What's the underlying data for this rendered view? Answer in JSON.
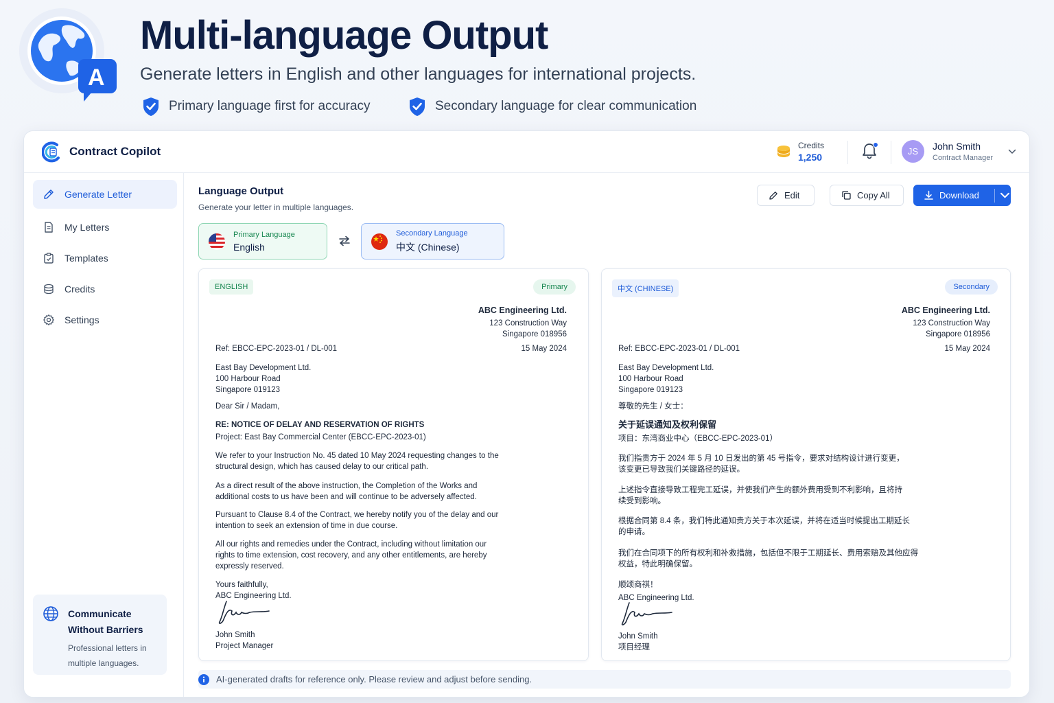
{
  "hero": {
    "title": "Multi-language Output",
    "subtitle": "Generate letters in English and other languages for international projects.",
    "badge_letter": "A",
    "features": [
      "Primary language first for accuracy",
      "Secondary language for clear communication"
    ]
  },
  "app": {
    "brand_name": "Contract Copilot",
    "credits_label": "Credits",
    "credits_value": "1,250",
    "user": {
      "initials": "JS",
      "name": "John Smith",
      "role": "Contract Manager"
    }
  },
  "sidebar": {
    "items": [
      {
        "label": "Generate Letter",
        "icon": "pencil-icon"
      },
      {
        "label": "My Letters",
        "icon": "document-icon"
      },
      {
        "label": "Templates",
        "icon": "clipboard-icon"
      },
      {
        "label": "Credits",
        "icon": "coins-icon"
      },
      {
        "label": "Settings",
        "icon": "gear-icon"
      }
    ],
    "promo": {
      "title": "Communicate Without Barriers",
      "text": "Professional letters in multiple languages."
    }
  },
  "main": {
    "title": "Language Output",
    "subtitle": "Generate your letter in multiple languages.",
    "buttons": {
      "edit": "Edit",
      "copy": "Copy All",
      "download": "Download"
    },
    "primary_language": {
      "label": "Primary Language",
      "value": "English"
    },
    "secondary_language": {
      "label": "Secondary Language",
      "value": "中文 (Chinese)"
    }
  },
  "letter_en": {
    "tag": "ENGLISH",
    "pill": "Primary",
    "company": "ABC Engineering Ltd.",
    "address1": "123 Construction Way",
    "address2": "Singapore 018956",
    "ref": "Ref: EBCC-EPC-2023-01 / DL-001",
    "date": "15 May 2024",
    "to1": "East Bay Development Ltd.",
    "to2": "100 Harbour Road",
    "to3": "Singapore 019123",
    "salutation": "Dear Sir / Madam,",
    "re": "RE: NOTICE OF DELAY AND RESERVATION OF RIGHTS",
    "project": "Project: East Bay Commercial Center (EBCC-EPC-2023-01)",
    "p1a": "We refer to your Instruction No. 45 dated 10 May 2024 requesting changes to the",
    "p1b": "structural design, which has caused delay to our critical path.",
    "p2a": "As a direct result of the above instruction, the Completion of the Works and",
    "p2b": "additional costs to us have been and will continue to be adversely affected.",
    "p3a": "Pursuant to Clause 8.4 of the Contract, we hereby notify you of the delay and our",
    "p3b": "intention to seek an extension of time in due course.",
    "p4a": "All our rights and remedies under the Contract, including without limitation our",
    "p4b": "rights to time extension, cost recovery, and any other entitlements, are hereby",
    "p4c": "expressly reserved.",
    "closing": "Yours faithfully,",
    "closing_co": "ABC Engineering Ltd.",
    "signer": "John Smith",
    "signer_title": "Project Manager"
  },
  "letter_zh": {
    "tag": "中文 (CHINESE)",
    "pill": "Secondary",
    "company": "ABC Engineering Ltd.",
    "address1": "123 Construction Way",
    "address2": "Singapore 018956",
    "ref": "Ref: EBCC-EPC-2023-01 / DL-001",
    "date": "15 May 2024",
    "to1": "East Bay Development Ltd.",
    "to2": "100 Harbour Road",
    "to3": "Singapore 019123",
    "salutation": "尊敬的先生 / 女士：",
    "re": "关于延误通知及权利保留",
    "project": "项目：东湾商业中心（EBCC-EPC-2023-01）",
    "p1a": "我们指贵方于 2024 年 5 月 10 日发出的第 45 号指令，要求对结构设计进行变更，",
    "p1b": "该变更已导致我们关键路径的延误。",
    "p2a": "上述指令直接导致工程完工延误，并使我们产生的额外费用受到不利影响，且将持",
    "p2b": "续受到影响。",
    "p3a": "根据合同第 8.4 条，我们特此通知贵方关于本次延误，并将在适当时候提出工期延长",
    "p3b": "的申请。",
    "p4a": "我们在合同项下的所有权利和补救措施，包括但不限于工期延长、费用索赔及其他应得",
    "p4b": "权益，特此明确保留。",
    "closing": "顺颂商祺！",
    "closing_co": "ABC Engineering Ltd.",
    "signer": "John Smith",
    "signer_title": "项目经理"
  },
  "notice": "AI-generated drafts for reference only. Please review and adjust before sending."
}
